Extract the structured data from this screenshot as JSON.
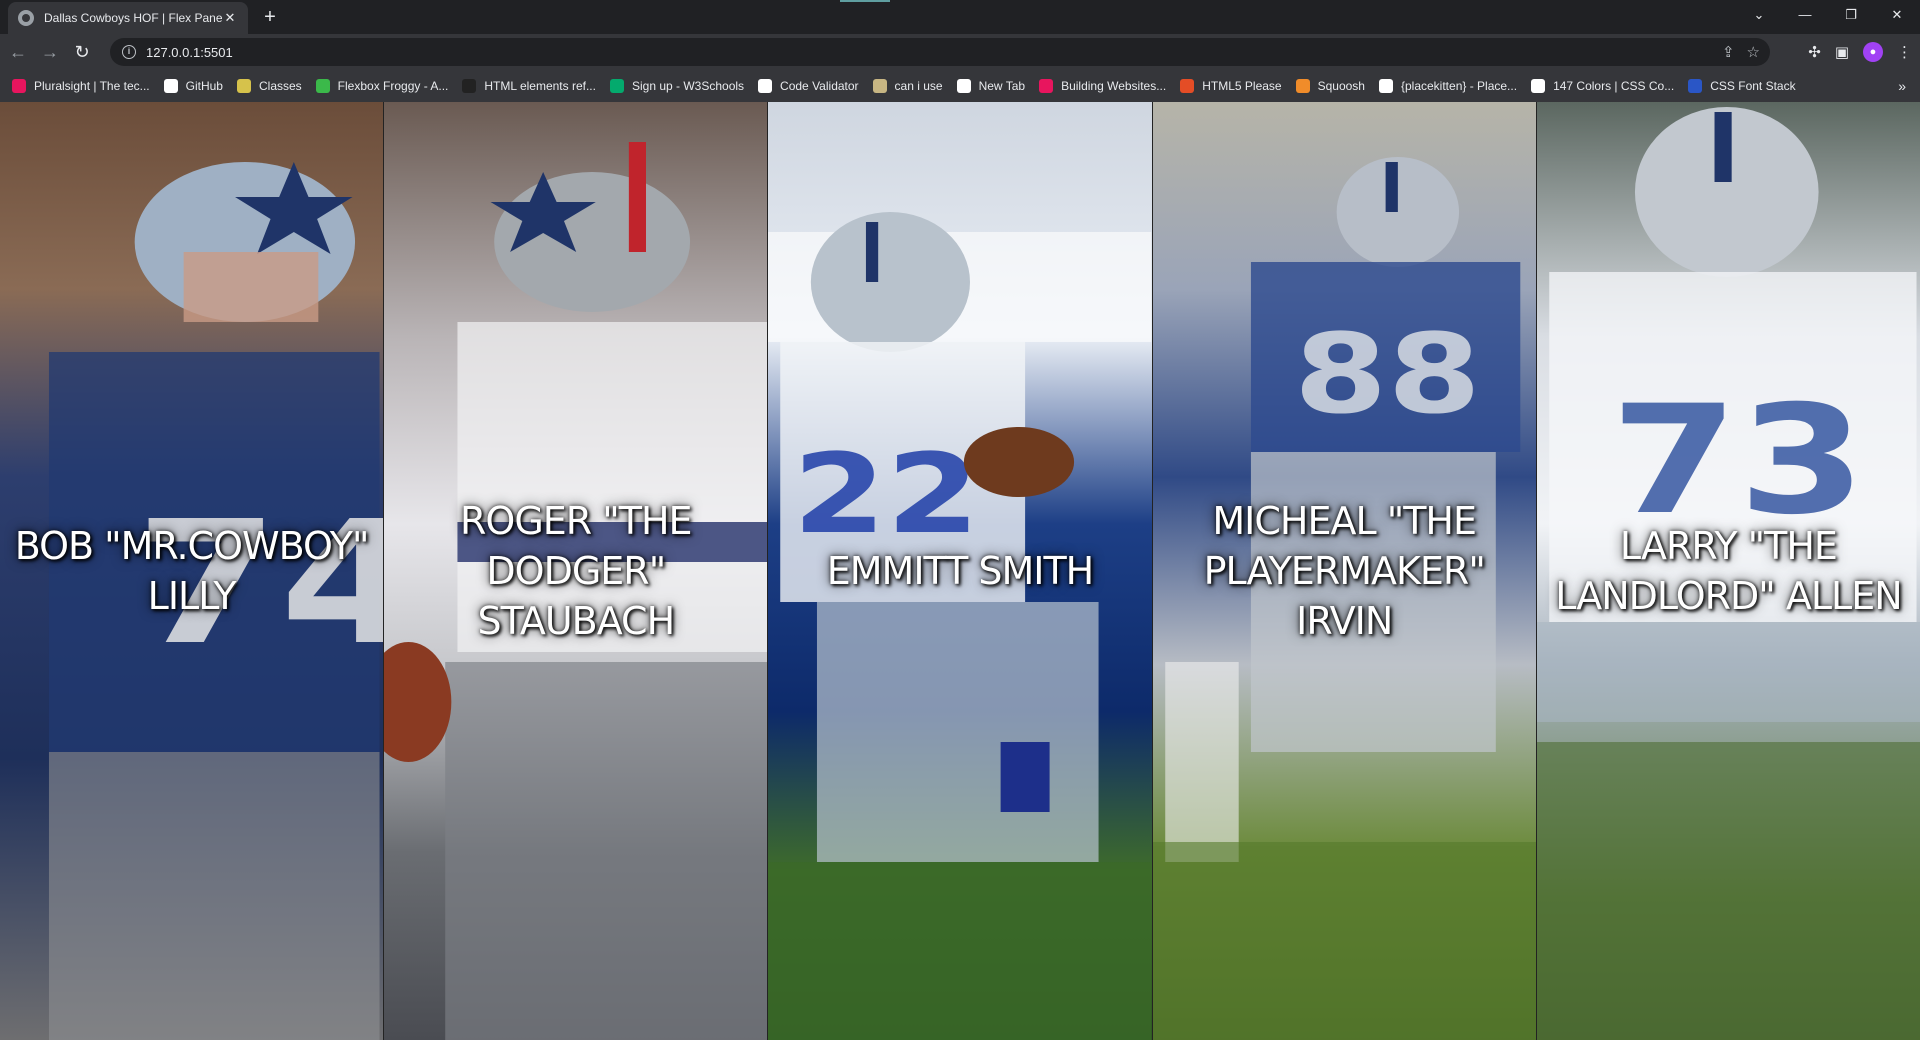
{
  "browser": {
    "tab_title": "Dallas Cowboys HOF | Flex Panel",
    "url": "127.0.0.1:5501",
    "bookmarks": [
      {
        "label": "Pluralsight | The tec...",
        "icon": "pluralsight-icon",
        "color": "#e8155e"
      },
      {
        "label": "GitHub",
        "icon": "github-icon",
        "color": "#ffffff"
      },
      {
        "label": "Classes",
        "icon": "classes-icon",
        "color": "#d6c24b"
      },
      {
        "label": "Flexbox Froggy - A...",
        "icon": "froggy-icon",
        "color": "#3bb94a"
      },
      {
        "label": "HTML elements ref...",
        "icon": "mdn-icon",
        "color": "#222222"
      },
      {
        "label": "Sign up - W3Schools",
        "icon": "w3schools-icon",
        "color": "#04aa6d"
      },
      {
        "label": "Code Validator",
        "icon": "w3c-icon",
        "color": "#ffffff"
      },
      {
        "label": "can i use",
        "icon": "caniuse-icon",
        "color": "#c7b683"
      },
      {
        "label": "New Tab",
        "icon": "globe-icon",
        "color": "#ffffff"
      },
      {
        "label": "Building Websites...",
        "icon": "pluralsight-icon",
        "color": "#e8155e"
      },
      {
        "label": "HTML5 Please",
        "icon": "html5-icon",
        "color": "#e44d26"
      },
      {
        "label": "Squoosh",
        "icon": "squoosh-icon",
        "color": "#f08c2a"
      },
      {
        "label": "{placekitten} - Place...",
        "icon": "placekitten-icon",
        "color": "#ffffff"
      },
      {
        "label": "147 Colors | CSS Co...",
        "icon": "globe-icon",
        "color": "#ffffff"
      },
      {
        "label": "CSS Font Stack",
        "icon": "fontstack-icon",
        "color": "#2a56c6"
      }
    ]
  },
  "panels": [
    {
      "name": "BOB \"MR.COWBOY\" LILLY",
      "number": "74"
    },
    {
      "name": "ROGER \"THE DODGER\" STAUBACH",
      "number": ""
    },
    {
      "name": "EMMITT SMITH",
      "number": "22"
    },
    {
      "name": "MICHEAL \"THE PLAYERMAKER\" IRVIN",
      "number": "88"
    },
    {
      "name": "LARRY \"THE LANDLORD\" ALLEN",
      "number": "73"
    }
  ]
}
